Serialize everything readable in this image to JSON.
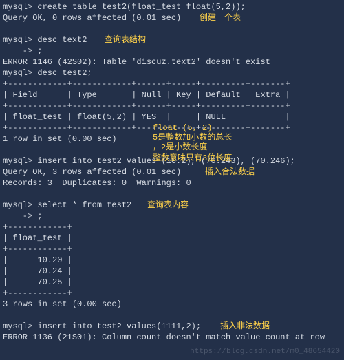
{
  "lines": {
    "l0": "mysql> create table test2(float_test float(5,2));",
    "l1": "Query OK, 0 rows affected (0.01 sec)",
    "l2": " ",
    "l3": "mysql> desc text2",
    "l4": "    -> ;",
    "l5": "ERROR 1146 (42S02): Table 'discuz.text2' doesn't exist",
    "l6": "mysql> desc test2;",
    "l7": "+------------+------------+------+-----+---------+-------+",
    "l8": "| Field      | Type       | Null | Key | Default | Extra |",
    "l9": "+------------+------------+------+-----+---------+-------+",
    "l10": "| float_test | float(5,2) | YES  |     | NULL    |       |",
    "l11": "+------------+------------+------+-----+---------+-------+",
    "l12": "1 row in set (0.00 sec)",
    "l13": " ",
    "l14": "mysql> insert into test2 values (10.2), (70.243), (70.246);",
    "l15": "Query OK, 3 rows affected (0.01 sec)",
    "l16": "Records: 3  Duplicates: 0  Warnings: 0",
    "l17": " ",
    "l18": "mysql> select * from test2",
    "l19": "    -> ;",
    "l20": "+------------+",
    "l21": "| float_test |",
    "l22": "+------------+",
    "l23": "|      10.20 |",
    "l24": "|      70.24 |",
    "l25": "|      70.25 |",
    "l26": "+------------+",
    "l27": "3 rows in set (0.00 sec)",
    "l28": " ",
    "l29": "mysql> insert into test2 values(1111,2);",
    "l30": "ERROR 1136 (21S01): Column count doesn't match value count at row "
  },
  "anno": {
    "a1": "创建一个表",
    "a2": "查询表结构",
    "a3": "float (5, 2)",
    "a4": "5是整数加小数的总长",
    "a5": "，2是小数长度",
    "a6": "整数意味只有3位长度",
    "a7": "插入合法数据",
    "a8": "查询表内容",
    "a9": "插入非法数据"
  },
  "watermark": "https://blog.csdn.net/m0_48654420"
}
